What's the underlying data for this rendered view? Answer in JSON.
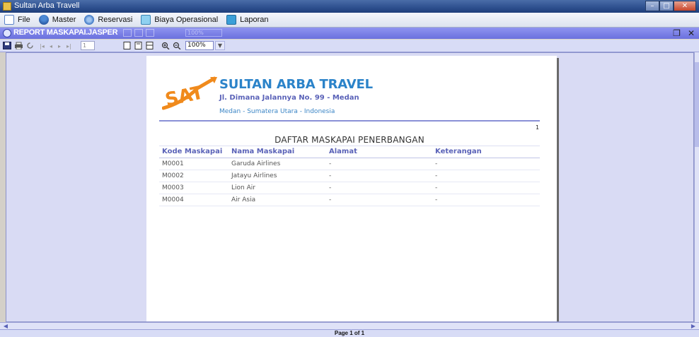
{
  "window": {
    "title": "Sultan Arba Travell",
    "buttons": [
      "minimize",
      "maximize",
      "close"
    ]
  },
  "menu": [
    {
      "label": "File",
      "icon": "file-icon"
    },
    {
      "label": "Master",
      "icon": "users-icon"
    },
    {
      "label": "Reservasi",
      "icon": "globe-icon"
    },
    {
      "label": "Biaya Operasional",
      "icon": "document-icon"
    },
    {
      "label": "Laporan",
      "icon": "report-icon"
    }
  ],
  "internal_frame": {
    "title": "REPORT MASKAPAI.JASPER"
  },
  "toolbar": {
    "page_field": "1",
    "zoom": "100%"
  },
  "report": {
    "company": "SULTAN ARBA TRAVEL",
    "address": "Jl. Dimana Jalannya No. 99 - Medan",
    "city": "Medan - Sumatera Utara - Indonesia",
    "logo_text": "SAT",
    "page_number": "1",
    "title": "DAFTAR MASKAPAI PENERBANGAN",
    "columns": [
      "Kode Maskapai",
      "Nama Maskapai",
      "Alamat",
      "Keterangan"
    ],
    "rows": [
      [
        "M0001",
        "Garuda Airlines",
        "-",
        "-"
      ],
      [
        "M0002",
        "Jatayu Airlines",
        "-",
        "-"
      ],
      [
        "M0003",
        "Lion Air",
        "-",
        "-"
      ],
      [
        "M0004",
        "Air Asia",
        "-",
        "-"
      ]
    ]
  },
  "status": {
    "page_label": "Page 1 of 1"
  },
  "colors": {
    "accent": "#2b83c9",
    "header_text": "#5a62b8",
    "logo_orange": "#f08a1c",
    "frame_bar": "#7a80e6"
  }
}
